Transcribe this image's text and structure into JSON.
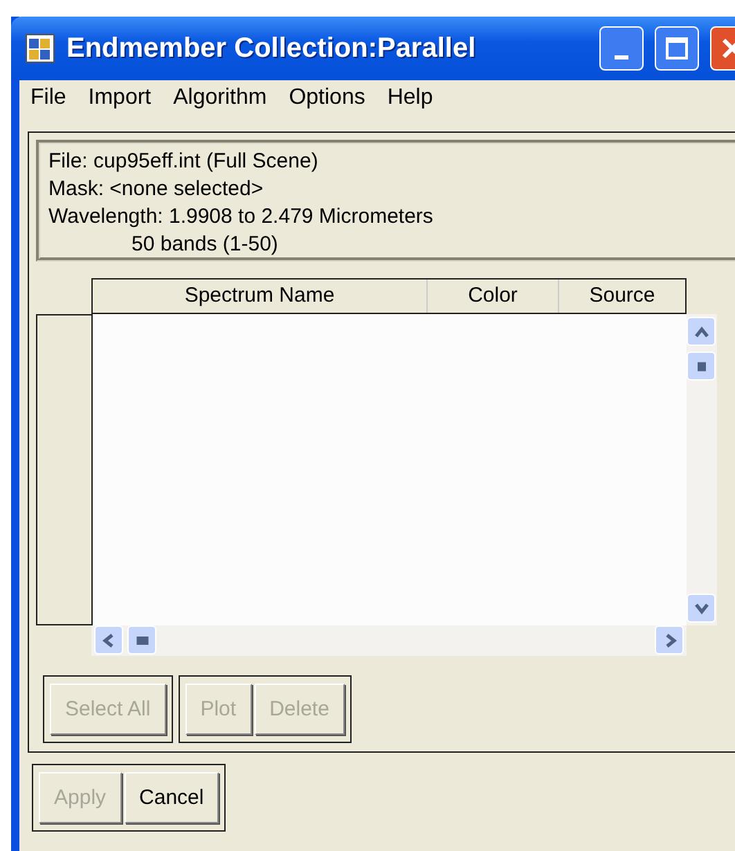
{
  "window": {
    "title": "Endmember Collection:Parallel"
  },
  "menu": [
    "File",
    "Import",
    "Algorithm",
    "Options",
    "Help"
  ],
  "info": [
    "File: cup95eff.int (Full Scene)",
    "Mask: <none selected>",
    "Wavelength: 1.9908 to 2.479 Micrometers",
    "50 bands (1-50)"
  ],
  "table": {
    "columns": [
      "Spectrum Name",
      "Color",
      "Source"
    ]
  },
  "list_buttons": [
    [
      {
        "label": "Select All",
        "disabled": true
      }
    ],
    [
      {
        "label": "Plot",
        "disabled": true
      },
      {
        "label": "Delete",
        "disabled": true
      }
    ]
  ],
  "dialog_buttons": [
    {
      "label": "Apply",
      "disabled": true
    },
    {
      "label": "Cancel",
      "disabled": false
    }
  ]
}
